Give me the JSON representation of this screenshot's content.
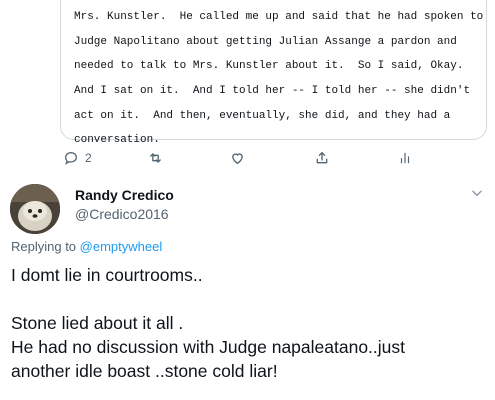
{
  "quoted": {
    "lines": [
      "Mrs. Kunstler.  He called me up and said that he had spoken to",
      "Judge Napolitano about getting Julian Assange a pardon and",
      "needed to talk to Mrs. Kunstler about it.  So I said, Okay.",
      "And I sat on it.  And I told her -- I told her -- she didn't",
      "act on it.  And then, eventually, she did, and they had a",
      "conversation."
    ]
  },
  "actions": {
    "reply_count": "2",
    "icons": [
      "reply-icon",
      "retweet-icon",
      "like-icon",
      "share-icon",
      "analytics-icon"
    ]
  },
  "author": {
    "name": "Randy Credico",
    "handle": "@Credico2016"
  },
  "replying": {
    "prefix": "Replying to ",
    "mention": "@emptywheel"
  },
  "tweet": {
    "line1": "I domt lie in courtrooms..",
    "line2": "Stone lied about it all .",
    "line3": "He had no discussion with Judge napaleatano..just",
    "line4": "another idle boast ..stone cold liar!"
  },
  "colors": {
    "accent": "#1d9bf0",
    "secondary_text": "#536471",
    "border": "#cfd9de"
  }
}
